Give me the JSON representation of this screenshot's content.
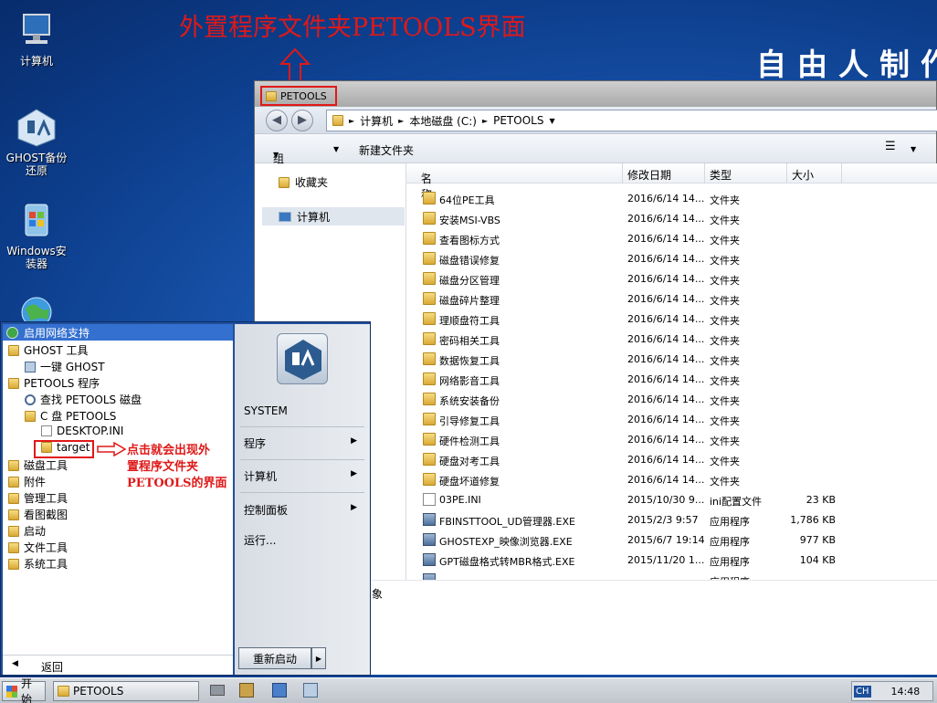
{
  "annotations": {
    "top_title": "外置程序文件夹PETOOLS界面",
    "brand": "自由人制作",
    "arrow_note_line1": "点击就会出现外",
    "arrow_note_line2": "置程序文件夹",
    "arrow_note_line3": "PETOOLS的界面"
  },
  "desktop": {
    "icons": [
      {
        "name": "computer",
        "label": "计算机",
        "icon": "computer-icon"
      },
      {
        "name": "ghost",
        "label": "GHOST备份还原",
        "icon": "ghost-icon"
      },
      {
        "name": "windows-installer",
        "label": "Windows安装器",
        "icon": "windows-installer-icon"
      },
      {
        "name": "network",
        "label": "",
        "icon": "globe-icon"
      }
    ]
  },
  "explorer": {
    "title": "PETOOLS",
    "address": {
      "parts": [
        "计算机",
        "本地磁盘 (C:)",
        "PETOOLS"
      ]
    },
    "toolbar": {
      "organize": "组织",
      "new_folder": "新建文件夹"
    },
    "nav": {
      "favorites": "收藏夹",
      "computer": "计算机"
    },
    "columns": {
      "name": "名称",
      "modified": "修改日期",
      "type": "类型",
      "size": "大小"
    },
    "files": [
      {
        "name": "64位PE工具",
        "date": "2016/6/14 14...",
        "type": "文件夹",
        "size": "",
        "icon": "folder"
      },
      {
        "name": "安装MSI-VBS",
        "date": "2016/6/14 14...",
        "type": "文件夹",
        "size": "",
        "icon": "folder"
      },
      {
        "name": "查看图标方式",
        "date": "2016/6/14 14...",
        "type": "文件夹",
        "size": "",
        "icon": "folder"
      },
      {
        "name": "磁盘错误修复",
        "date": "2016/6/14 14...",
        "type": "文件夹",
        "size": "",
        "icon": "folder"
      },
      {
        "name": "磁盘分区管理",
        "date": "2016/6/14 14...",
        "type": "文件夹",
        "size": "",
        "icon": "folder"
      },
      {
        "name": "磁盘碎片整理",
        "date": "2016/6/14 14...",
        "type": "文件夹",
        "size": "",
        "icon": "folder"
      },
      {
        "name": "理顺盘符工具",
        "date": "2016/6/14 14...",
        "type": "文件夹",
        "size": "",
        "icon": "folder"
      },
      {
        "name": "密码相关工具",
        "date": "2016/6/14 14...",
        "type": "文件夹",
        "size": "",
        "icon": "folder"
      },
      {
        "name": "数据恢复工具",
        "date": "2016/6/14 14...",
        "type": "文件夹",
        "size": "",
        "icon": "folder"
      },
      {
        "name": "网络影音工具",
        "date": "2016/6/14 14...",
        "type": "文件夹",
        "size": "",
        "icon": "folder"
      },
      {
        "name": "系统安装备份",
        "date": "2016/6/14 14...",
        "type": "文件夹",
        "size": "",
        "icon": "folder"
      },
      {
        "name": "引导修复工具",
        "date": "2016/6/14 14...",
        "type": "文件夹",
        "size": "",
        "icon": "folder"
      },
      {
        "name": "硬件检测工具",
        "date": "2016/6/14 14...",
        "type": "文件夹",
        "size": "",
        "icon": "folder"
      },
      {
        "name": "硬盘对考工具",
        "date": "2016/6/14 14...",
        "type": "文件夹",
        "size": "",
        "icon": "folder"
      },
      {
        "name": "硬盘坏道修复",
        "date": "2016/6/14 14...",
        "type": "文件夹",
        "size": "",
        "icon": "folder"
      },
      {
        "name": "03PE.INI",
        "date": "2015/10/30 9...",
        "type": "ini配置文件",
        "size": "23 KB",
        "icon": "ini"
      },
      {
        "name": "FBINSTTOOL_UD管理器.EXE",
        "date": "2015/2/3 9:57",
        "type": "应用程序",
        "size": "1,786 KB",
        "icon": "exe"
      },
      {
        "name": "GHOSTEXP_映像浏览器.EXE",
        "date": "2015/6/7 19:14",
        "type": "应用程序",
        "size": "977 KB",
        "icon": "exe"
      },
      {
        "name": "GPT磁盘格式转MBR格式.EXE",
        "date": "2015/11/20 1...",
        "type": "应用程序",
        "size": "104 KB",
        "icon": "exe"
      },
      {
        "name": "",
        "date": "",
        "type": "应用程序",
        "size": "",
        "icon": "exe"
      }
    ],
    "status_text": "象"
  },
  "start_menu": {
    "header": "启用网络支持",
    "tree": [
      {
        "label": "GHOST 工具",
        "icon": "folder"
      },
      {
        "label": "一键 GHOST",
        "icon": "ghost"
      },
      {
        "label": "PETOOLS 程序",
        "icon": "folder"
      },
      {
        "label": "查找 PETOOLS 磁盘",
        "icon": "search"
      },
      {
        "label": "C 盘 PETOOLS",
        "icon": "folder"
      },
      {
        "label": "DESKTOP.INI",
        "icon": "file"
      },
      {
        "label": "target",
        "icon": "folder"
      },
      {
        "label": "磁盘工具",
        "icon": "folder"
      },
      {
        "label": "附件",
        "icon": "folder"
      },
      {
        "label": "管理工具",
        "icon": "folder"
      },
      {
        "label": "看图截图",
        "icon": "folder"
      },
      {
        "label": "启动",
        "icon": "folder"
      },
      {
        "label": "文件工具",
        "icon": "folder"
      },
      {
        "label": "系统工具",
        "icon": "folder"
      }
    ],
    "back": "返回",
    "user": "SYSTEM",
    "right": {
      "programs": "程序",
      "computer": "计算机",
      "control_panel": "控制面板",
      "run": "运行..."
    },
    "restart": "重新启动"
  },
  "taskbar": {
    "start": "开始",
    "window": "PETOOLS",
    "lang": "CH",
    "time": "14:48"
  }
}
